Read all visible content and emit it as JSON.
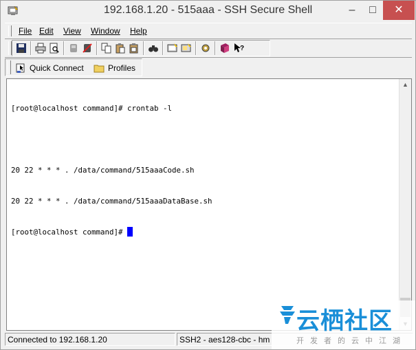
{
  "window": {
    "title": "192.168.1.20 - 515aaa - SSH Secure Shell",
    "min_glyph": "–",
    "max_glyph": "□",
    "close_glyph": "✕"
  },
  "menu": {
    "items": [
      "File",
      "Edit",
      "View",
      "Window",
      "Help"
    ]
  },
  "toolbar": {
    "icons": [
      "save-icon",
      "print-icon",
      "print-preview-icon",
      "disconnect-icon",
      "connect-icon",
      "copy-icon",
      "paste-icon",
      "paste-alt-icon",
      "find-icon",
      "new-terminal-icon",
      "new-file-transfer-icon",
      "settings-icon",
      "help-book-icon",
      "context-help-icon"
    ]
  },
  "quick_connect": {
    "quick_connect_label": "Quick Connect",
    "profiles_label": "Profiles"
  },
  "terminal": {
    "lines": [
      "[root@localhost command]# crontab -l",
      "",
      "20 22 * * * . /data/command/515aaaCode.sh",
      "20 22 * * * . /data/command/515aaaDataBase.sh"
    ],
    "prompt": "[root@localhost command]# "
  },
  "status": {
    "connection": "Connected to 192.168.1.20",
    "cipher": "SSH2 - aes128-cbc - hm"
  },
  "watermark": {
    "title": "云栖社区",
    "subtitle": "开发者的云中江湖"
  },
  "colors": {
    "cursor": "#0000ff",
    "close_button": "#c75050",
    "watermark_blue": "#1a8fd8"
  }
}
